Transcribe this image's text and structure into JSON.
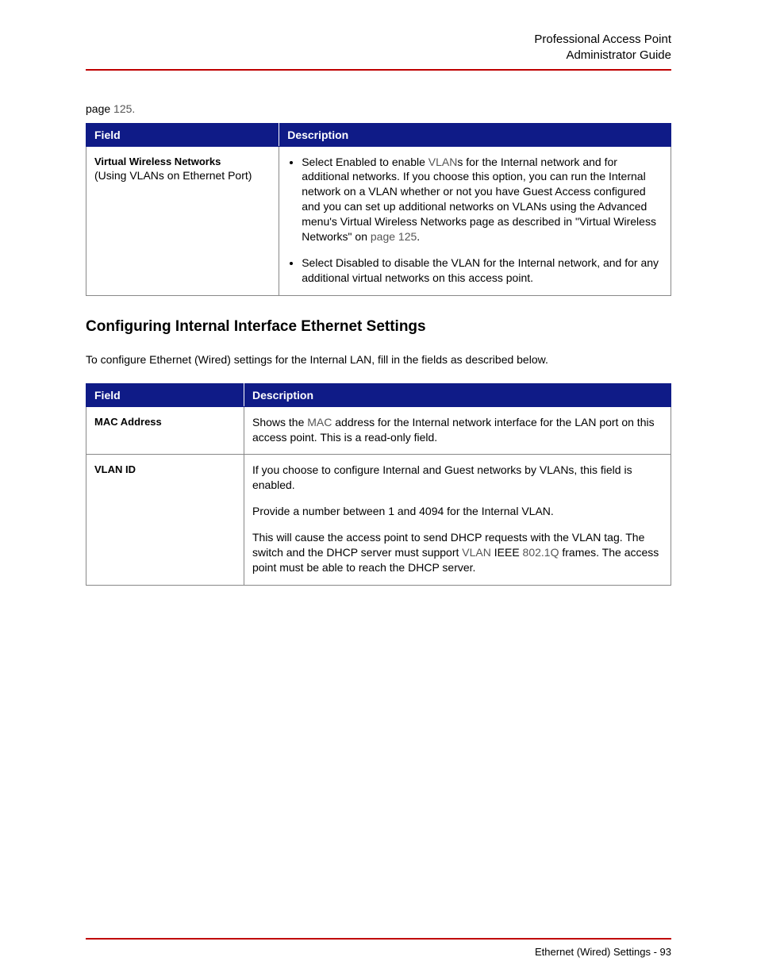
{
  "header": {
    "line1": "Professional Access Point",
    "line2": "Administrator Guide"
  },
  "intro_ref_prefix": "page ",
  "intro_ref_page": "125.",
  "table1": {
    "headers": {
      "field": "Field",
      "description": "Description"
    },
    "row": {
      "field_title": "Virtual Wireless Networks",
      "field_sub": "(Using VLANs on Ethernet Port)",
      "bullet1_a": "Select Enabled to enable ",
      "bullet1_b": "VLAN",
      "bullet1_c": "s for the Internal network and for additional networks. If you choose this option, you can run the Internal network on a VLAN whether or not you have Guest Access configured and you can set up additional networks on VLANs using the Advanced menu's Virtual Wireless Networks page as described in \"Virtual Wireless Networks\" on ",
      "bullet1_d": "page 125",
      "bullet1_e": ".",
      "bullet2": "Select Disabled to disable the VLAN for the Internal network, and for any additional virtual networks on this access point."
    }
  },
  "section_heading": "Configuring Internal Interface Ethernet Settings",
  "intro_text": "To configure Ethernet (Wired) settings for the Internal LAN, fill in the fields as described below.",
  "table2": {
    "headers": {
      "field": "Field",
      "description": "Description"
    },
    "rows": {
      "mac": {
        "field": "MAC Address",
        "desc_a": "Shows the ",
        "desc_b": "MAC",
        "desc_c": " address for the Internal network interface for the LAN port on this access point. This is a read-only field."
      },
      "vlan": {
        "field": "VLAN ID",
        "p1": "If you choose to configure Internal and Guest networks by VLANs, this field is enabled.",
        "p2": "Provide a number between 1 and 4094 for the Internal VLAN.",
        "p3_a": "This will cause the access point to send DHCP requests with the VLAN tag. The switch and the DHCP server must support ",
        "p3_b": "VLAN",
        "p3_c": " IEEE ",
        "p3_d": "802.1Q",
        "p3_e": " frames. The access point must be able to reach the DHCP server."
      }
    }
  },
  "footer": {
    "section": "Ethernet (Wired) Settings",
    "sep": " - ",
    "page": "93"
  }
}
